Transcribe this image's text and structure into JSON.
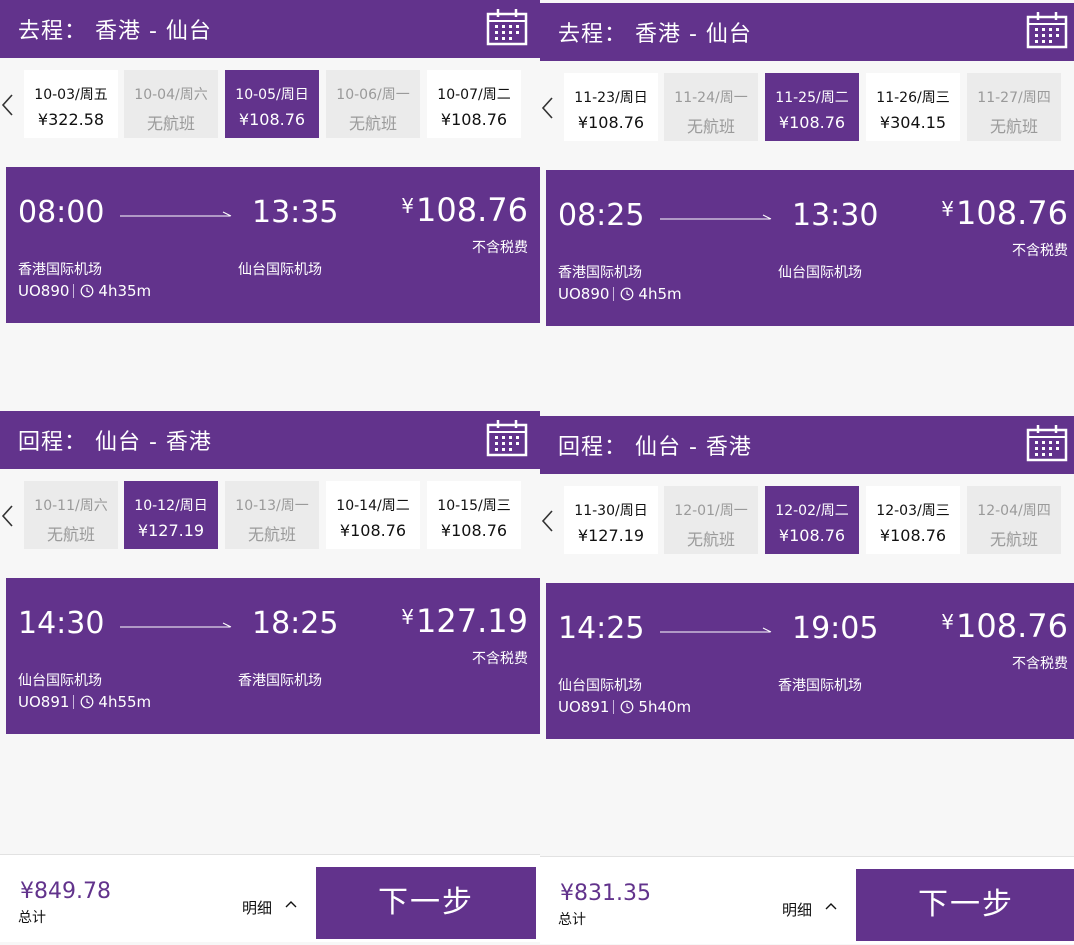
{
  "panels": [
    {
      "outbound": {
        "title": "去程： 香港 - 仙台",
        "dates": [
          {
            "date": "10-03/周五",
            "price": "¥322.58",
            "state": "normal"
          },
          {
            "date": "10-04/周六",
            "price": "无航班",
            "state": "disabled"
          },
          {
            "date": "10-05/周日",
            "price": "¥108.76",
            "state": "selected"
          },
          {
            "date": "10-06/周一",
            "price": "无航班",
            "state": "disabled"
          },
          {
            "date": "10-07/周二",
            "price": "¥108.76",
            "state": "normal"
          }
        ],
        "flight": {
          "dep_time": "08:00",
          "arr_time": "13:35",
          "currency": "¥",
          "price": "108.76",
          "tax_note": "不含税费",
          "dep_airport": "香港国际机场",
          "arr_airport": "仙台国际机场",
          "flight_no": "UO890",
          "duration": "4h35m"
        }
      },
      "return": {
        "title": "回程： 仙台 - 香港",
        "dates": [
          {
            "date": "10-11/周六",
            "price": "无航班",
            "state": "disabled"
          },
          {
            "date": "10-12/周日",
            "price": "¥127.19",
            "state": "selected"
          },
          {
            "date": "10-13/周一",
            "price": "无航班",
            "state": "disabled"
          },
          {
            "date": "10-14/周二",
            "price": "¥108.76",
            "state": "normal"
          },
          {
            "date": "10-15/周三",
            "price": "¥108.76",
            "state": "normal"
          }
        ],
        "flight": {
          "dep_time": "14:30",
          "arr_time": "18:25",
          "currency": "¥",
          "price": "127.19",
          "tax_note": "不含税费",
          "dep_airport": "仙台国际机场",
          "arr_airport": "香港国际机场",
          "flight_no": "UO891",
          "duration": "4h55m"
        }
      },
      "footer": {
        "total": "¥849.78",
        "total_label": "总计",
        "details": "明细",
        "next": "下一步"
      }
    },
    {
      "outbound": {
        "title": "去程： 香港 - 仙台",
        "dates": [
          {
            "date": "11-23/周日",
            "price": "¥108.76",
            "state": "normal"
          },
          {
            "date": "11-24/周一",
            "price": "无航班",
            "state": "disabled"
          },
          {
            "date": "11-25/周二",
            "price": "¥108.76",
            "state": "selected"
          },
          {
            "date": "11-26/周三",
            "price": "¥304.15",
            "state": "normal"
          },
          {
            "date": "11-27/周四",
            "price": "无航班",
            "state": "disabled"
          }
        ],
        "flight": {
          "dep_time": "08:25",
          "arr_time": "13:30",
          "currency": "¥",
          "price": "108.76",
          "tax_note": "不含税费",
          "dep_airport": "香港国际机场",
          "arr_airport": "仙台国际机场",
          "flight_no": "UO890",
          "duration": "4h5m"
        }
      },
      "return": {
        "title": "回程： 仙台 - 香港",
        "dates": [
          {
            "date": "11-30/周日",
            "price": "¥127.19",
            "state": "normal"
          },
          {
            "date": "12-01/周一",
            "price": "无航班",
            "state": "disabled"
          },
          {
            "date": "12-02/周二",
            "price": "¥108.76",
            "state": "selected"
          },
          {
            "date": "12-03/周三",
            "price": "¥108.76",
            "state": "normal"
          },
          {
            "date": "12-04/周四",
            "price": "无航班",
            "state": "disabled"
          }
        ],
        "flight": {
          "dep_time": "14:25",
          "arr_time": "19:05",
          "currency": "¥",
          "price": "108.76",
          "tax_note": "不含税费",
          "dep_airport": "仙台国际机场",
          "arr_airport": "香港国际机场",
          "flight_no": "UO891",
          "duration": "5h40m"
        }
      },
      "footer": {
        "total": "¥831.35",
        "total_label": "总计",
        "details": "明细",
        "next": "下一步"
      }
    }
  ],
  "colors": {
    "brand": "#62338c",
    "disabled_bg": "#ebebeb",
    "disabled_text": "#9a9a9a"
  },
  "icons": {
    "calendar": "calendar-icon",
    "prev": "chevron-left-icon",
    "clock": "clock-icon",
    "details": "chevron-up-icon"
  }
}
